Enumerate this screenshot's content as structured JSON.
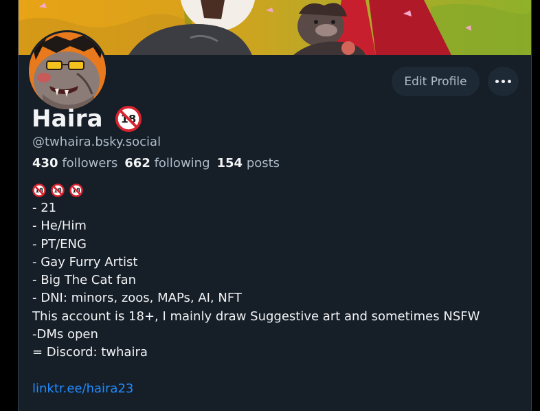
{
  "profile": {
    "display_name": "Haira",
    "name_badge_icon": "no-under-18-icon",
    "handle": "@twhaira.bsky.social",
    "stats": {
      "followers_count": "430",
      "followers_label": "followers",
      "following_count": "662",
      "following_label": "following",
      "posts_count": "154",
      "posts_label": "posts"
    }
  },
  "actions": {
    "edit_profile_label": "Edit Profile",
    "more_icon": "more-dots-icon"
  },
  "bio": {
    "emoji_icons": [
      "no-under-18-icon",
      "no-under-18-icon",
      "no-under-18-icon"
    ],
    "lines": [
      "- 21",
      "- He/Him",
      "- PT/ENG",
      "- Gay Furry Artist",
      "- Big The Cat fan",
      "- DNI: minors, zoos, MAPs, AI, NFT",
      "This account is 18+, I mainly draw Suggestive art and sometimes NSFW",
      "-DMs open",
      "= Discord: twhaira"
    ],
    "link": "linktr.ee/haira23"
  },
  "colors": {
    "background": "#161e27",
    "button_bg": "#1e2936",
    "muted_text": "#aebbc9",
    "link": "#208bfe",
    "badge_red": "#d8232f"
  }
}
